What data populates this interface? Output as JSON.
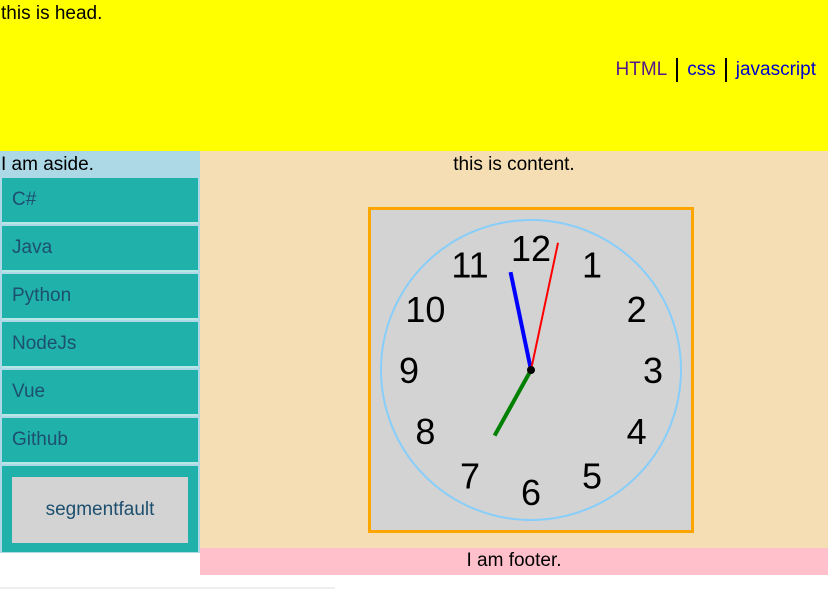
{
  "header": {
    "title": "this is head.",
    "nav": [
      {
        "label": "HTML"
      },
      {
        "label": "css"
      },
      {
        "label": "javascript"
      }
    ]
  },
  "aside": {
    "label": "I am aside.",
    "menu": [
      "C#",
      "Java",
      "Python",
      "NodeJs",
      "Vue",
      "Github"
    ],
    "button_label": "segmentfault"
  },
  "content": {
    "label": "this is content."
  },
  "clock": {
    "numbers": [
      "12",
      "1",
      "2",
      "3",
      "4",
      "5",
      "6",
      "7",
      "8",
      "9",
      "10",
      "11"
    ],
    "time": {
      "hour": 6,
      "minute": 58,
      "second": 2
    },
    "colors": {
      "face": "#d3d3d3",
      "rim": "#87cefa",
      "border": "#ffa500",
      "hour_hand": "#008000",
      "minute_hand": "#0000ff",
      "second_hand": "#ff0000"
    }
  },
  "footer": {
    "label": "I am footer."
  }
}
